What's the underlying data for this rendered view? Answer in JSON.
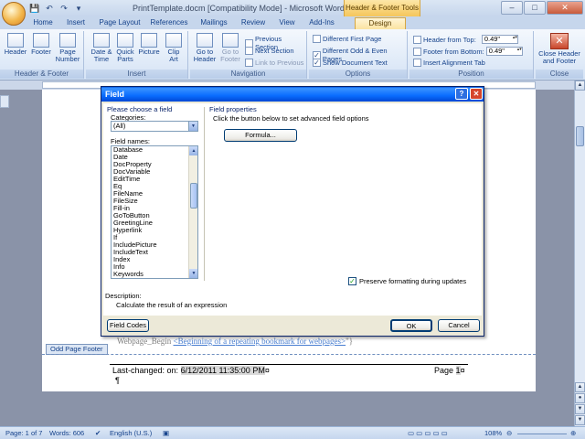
{
  "titlebar": {
    "title": "PrintTemplate.docm [Compatibility Mode] - Microsoft Word",
    "context_tools": "Header & Footer Tools",
    "window_buttons": {
      "minimize": "–",
      "maximize": "□",
      "close": "✕"
    }
  },
  "tabs": [
    "Home",
    "Insert",
    "Page Layout",
    "References",
    "Mailings",
    "Review",
    "View",
    "Add-Ins",
    "Design"
  ],
  "ribbon": {
    "groups": {
      "header_footer": {
        "label": "Header & Footer",
        "header": "Header",
        "footer": "Footer",
        "page_number": "Page Number"
      },
      "insert": {
        "label": "Insert",
        "date_time": "Date & Time",
        "quick_parts": "Quick Parts",
        "picture": "Picture",
        "clip_art": "Clip Art"
      },
      "navigation": {
        "label": "Navigation",
        "go_to_header": "Go to Header",
        "go_to_footer": "Go to Footer",
        "previous_section": "Previous Section",
        "next_section": "Next Section",
        "link_to_previous": "Link to Previous"
      },
      "options": {
        "label": "Options",
        "different_first_page": "Different First Page",
        "different_odd_even": "Different Odd & Even Pages",
        "show_document_text": "Show Document Text"
      },
      "position": {
        "label": "Position",
        "header_from_top": "Header from Top:",
        "header_from_top_value": "0.49\"",
        "footer_from_bottom": "Footer from Bottom:",
        "footer_from_bottom_value": "0.49\"",
        "insert_alignment_tab": "Insert Alignment Tab"
      },
      "close": {
        "label": "Close",
        "close_header_footer": "Close Header and Footer"
      }
    }
  },
  "dialog": {
    "title": "Field",
    "help_button": "?",
    "close_button": "✕",
    "choose_field": "Please choose a field",
    "categories_label": "Categories:",
    "categories_value": "(All)",
    "field_names_label": "Field names:",
    "field_names": [
      "Database",
      "Date",
      "DocProperty",
      "DocVariable",
      "EditTime",
      "Eq",
      "FileName",
      "FileSize",
      "Fill-in",
      "GoToButton",
      "GreetingLine",
      "Hyperlink",
      "If",
      "IncludePicture",
      "IncludeText",
      "Index",
      "Info",
      "Keywords"
    ],
    "field_properties": "Field properties",
    "click_button_text": "Click the button below to set advanced field options",
    "formula_button": "Formula...",
    "preserve_formatting": "Preserve formatting during updates",
    "description_label": "Description:",
    "description_text": "Calculate the result of an expression",
    "field_codes_button": "Field Codes",
    "ok_button": "OK",
    "cancel_button": "Cancel"
  },
  "document": {
    "body_prefix": "Webpage_Begin",
    "body_link": "<Beginning of a repeating bookmark for webpages>",
    "body_suffix": "\"}",
    "footer_tag": "Odd Page Footer",
    "footer_label": "Last-changed: on:",
    "footer_date": "6/12/2011 11:35:00 PM",
    "footer_marker": "¤",
    "page_label": "Page",
    "page_number": "1",
    "pilcrow": "¶"
  },
  "statusbar": {
    "page": "Page: 1 of 7",
    "words": "Words: 606",
    "language": "English (U.S.)",
    "zoom": "108%"
  }
}
